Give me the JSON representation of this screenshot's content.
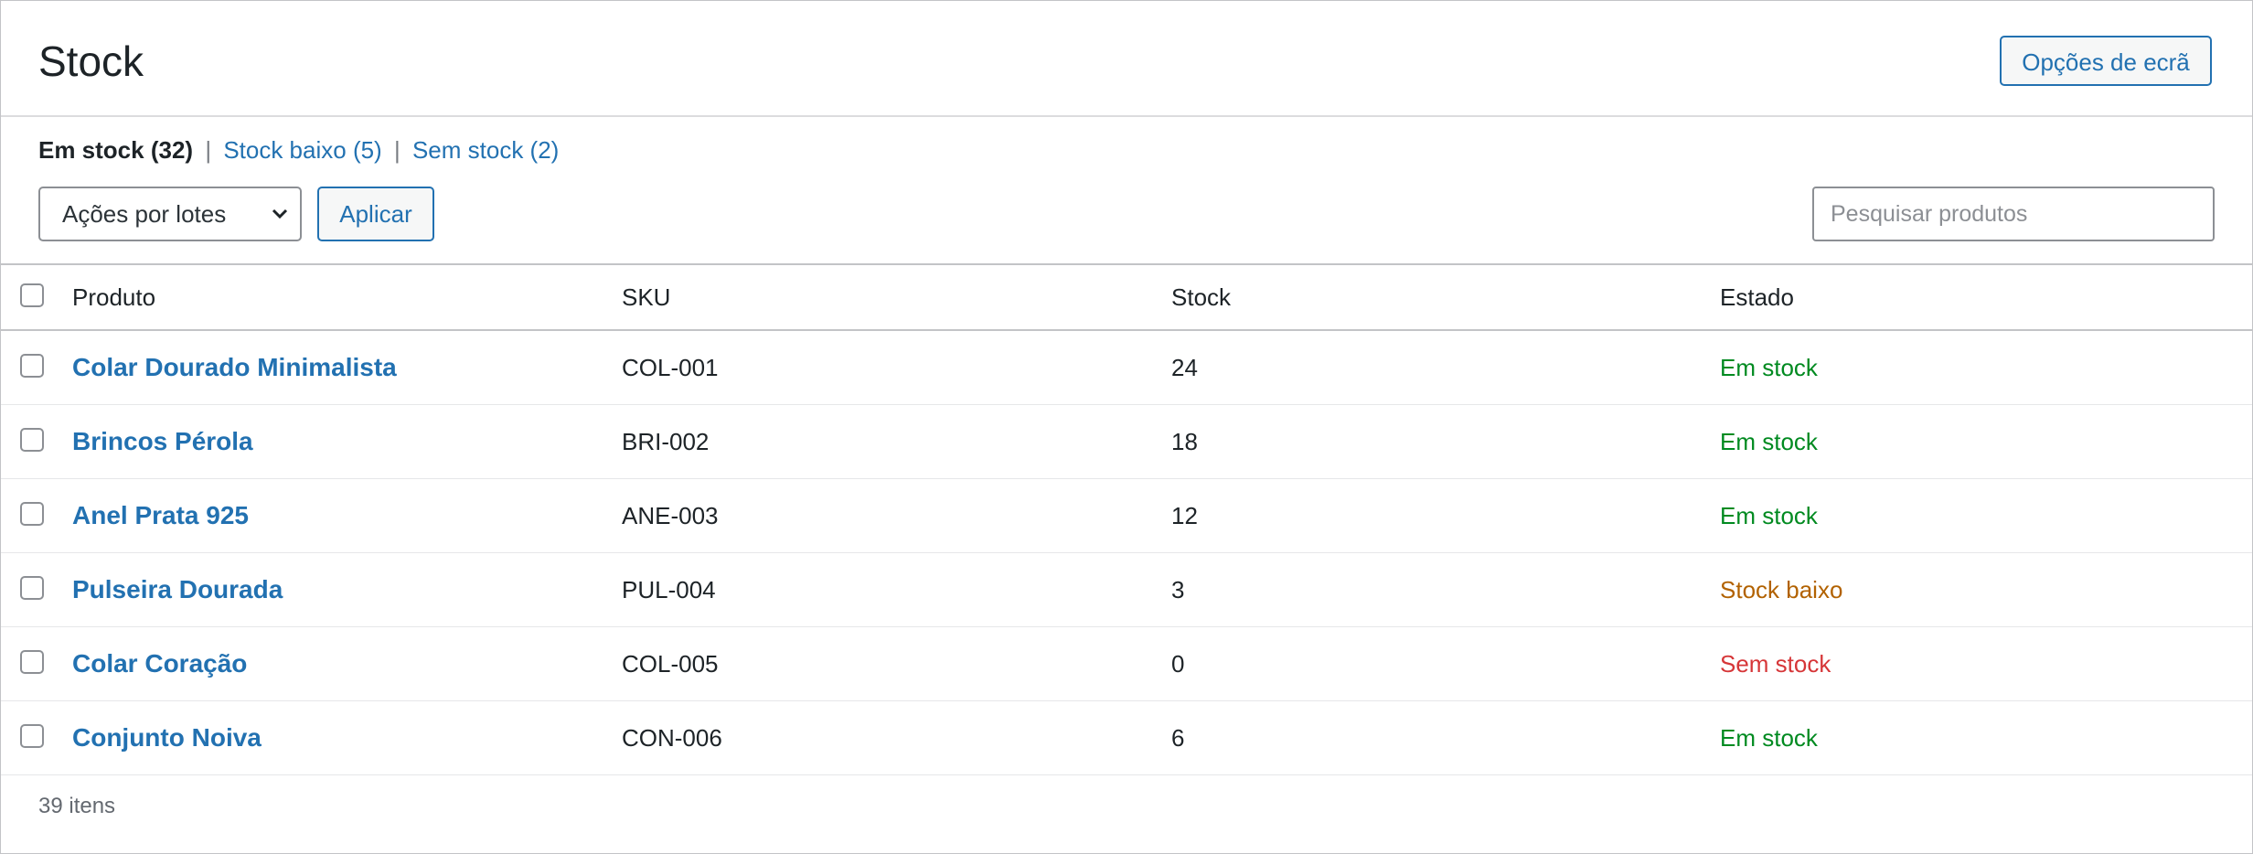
{
  "header": {
    "title": "Stock",
    "screen_options_label": "Opções de ecrã"
  },
  "filters": {
    "current": "Em stock (32)",
    "separator": "|",
    "low": "Stock baixo (5)",
    "out": "Sem stock (2)"
  },
  "bulk": {
    "selected": "Ações por lotes",
    "apply_label": "Aplicar"
  },
  "search": {
    "placeholder": "Pesquisar produtos",
    "value": ""
  },
  "table": {
    "columns": {
      "product": "Produto",
      "sku": "SKU",
      "stock": "Stock",
      "state": "Estado"
    },
    "rows": [
      {
        "product": "Colar Dourado Minimalista",
        "sku": "COL-001",
        "stock": "24",
        "state": "Em stock",
        "state_kind": "in"
      },
      {
        "product": "Brincos Pérola",
        "sku": "BRI-002",
        "stock": "18",
        "state": "Em stock",
        "state_kind": "in"
      },
      {
        "product": "Anel Prata 925",
        "sku": "ANE-003",
        "stock": "12",
        "state": "Em stock",
        "state_kind": "in"
      },
      {
        "product": "Pulseira Dourada",
        "sku": "PUL-004",
        "stock": "3",
        "state": "Stock baixo",
        "state_kind": "low"
      },
      {
        "product": "Colar Coração",
        "sku": "COL-005",
        "stock": "0",
        "state": "Sem stock",
        "state_kind": "out"
      },
      {
        "product": "Conjunto Noiva",
        "sku": "CON-006",
        "stock": "6",
        "state": "Em stock",
        "state_kind": "in"
      }
    ]
  },
  "footer": {
    "count": "39 itens"
  },
  "colors": {
    "accent": "#2271b1",
    "in_stock": "#008a20",
    "low_stock": "#b26200",
    "out_of_stock": "#d63638"
  },
  "icons": {
    "bulk_dropdown": "chevron-down-icon"
  }
}
